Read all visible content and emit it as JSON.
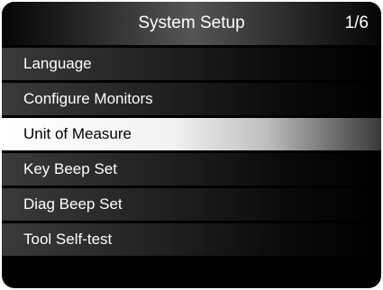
{
  "header": {
    "title": "System Setup",
    "page_indicator": "1/6"
  },
  "menu": {
    "items": [
      {
        "label": "Language"
      },
      {
        "label": "Configure Monitors"
      },
      {
        "label": "Unit of Measure",
        "selected": true
      },
      {
        "label": "Key Beep Set"
      },
      {
        "label": "Diag Beep Set"
      },
      {
        "label": "Tool Self-test"
      }
    ]
  }
}
